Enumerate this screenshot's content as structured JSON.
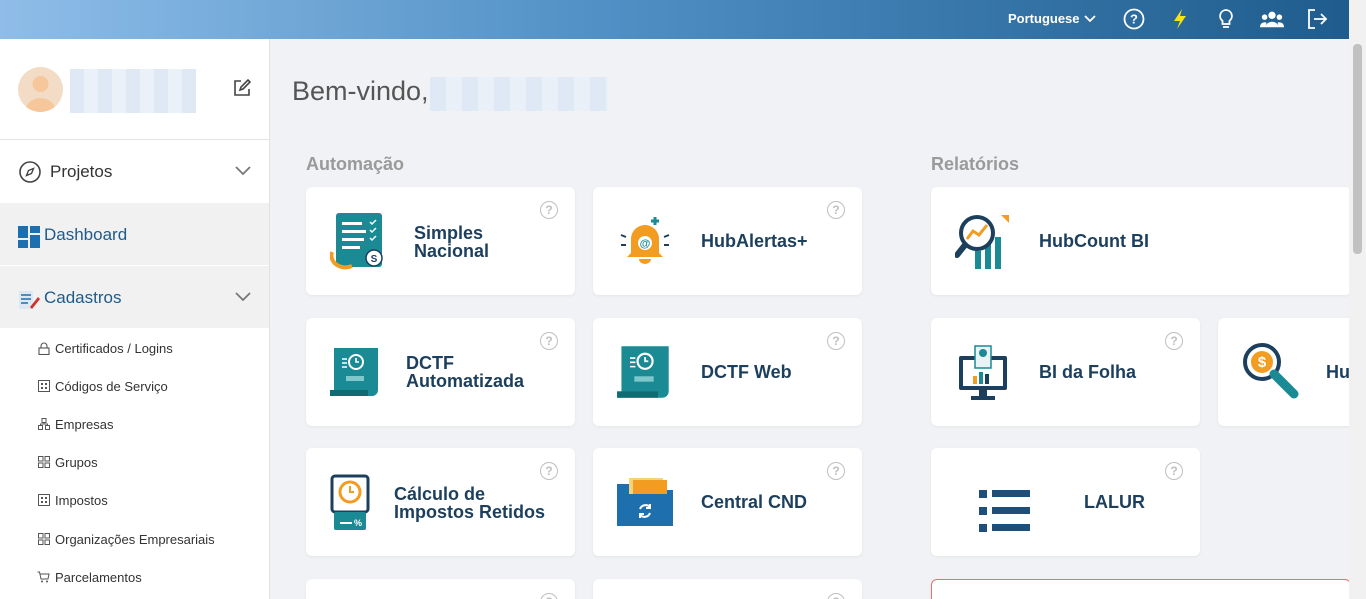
{
  "topbar": {
    "language": "Portuguese",
    "icons": [
      "help-circle-icon",
      "lightning-icon",
      "lightbulb-icon",
      "users-icon",
      "logout-icon"
    ]
  },
  "sidebar": {
    "menu": [
      {
        "label": "Projetos",
        "icon": "compass-icon"
      },
      {
        "label": "Dashboard",
        "icon": "dashboard-icon"
      },
      {
        "label": "Cadastros",
        "icon": "edit-list-icon"
      }
    ],
    "sub_items": [
      {
        "label": "Certificados / Logins",
        "icon": "lock-icon"
      },
      {
        "label": "Códigos de Serviço",
        "icon": "code-box-icon"
      },
      {
        "label": "Empresas",
        "icon": "building-icon"
      },
      {
        "label": "Grupos",
        "icon": "grid-icon"
      },
      {
        "label": "Impostos",
        "icon": "code-box-icon"
      },
      {
        "label": "Organizações Empresariais",
        "icon": "grid-icon"
      },
      {
        "label": "Parcelamentos",
        "icon": "cart-icon"
      }
    ]
  },
  "main": {
    "welcome": "Bem-vindo,",
    "sections": {
      "automacao": "Automação",
      "relatorios": "Relatórios"
    },
    "cards": {
      "simples_l1": "Simples",
      "simples_l2": "Nacional",
      "hubalertas": "HubAlertas+",
      "dctf_l1": "DCTF",
      "dctf_l2": "Automatizada",
      "dctfweb": "DCTF Web",
      "calculo_l1": "Cálculo de",
      "calculo_l2": "Impostos Retidos",
      "cnd": "Central CND",
      "hubcount": "HubCount BI",
      "bifolha": "BI da Folha",
      "hu": "Hu",
      "lalur": "LALUR"
    },
    "help_glyph": "?"
  },
  "colors": {
    "brand_dark": "#1d3f5e",
    "teal": "#1a8a94",
    "orange": "#f39c22",
    "blue": "#1e5b8c"
  }
}
